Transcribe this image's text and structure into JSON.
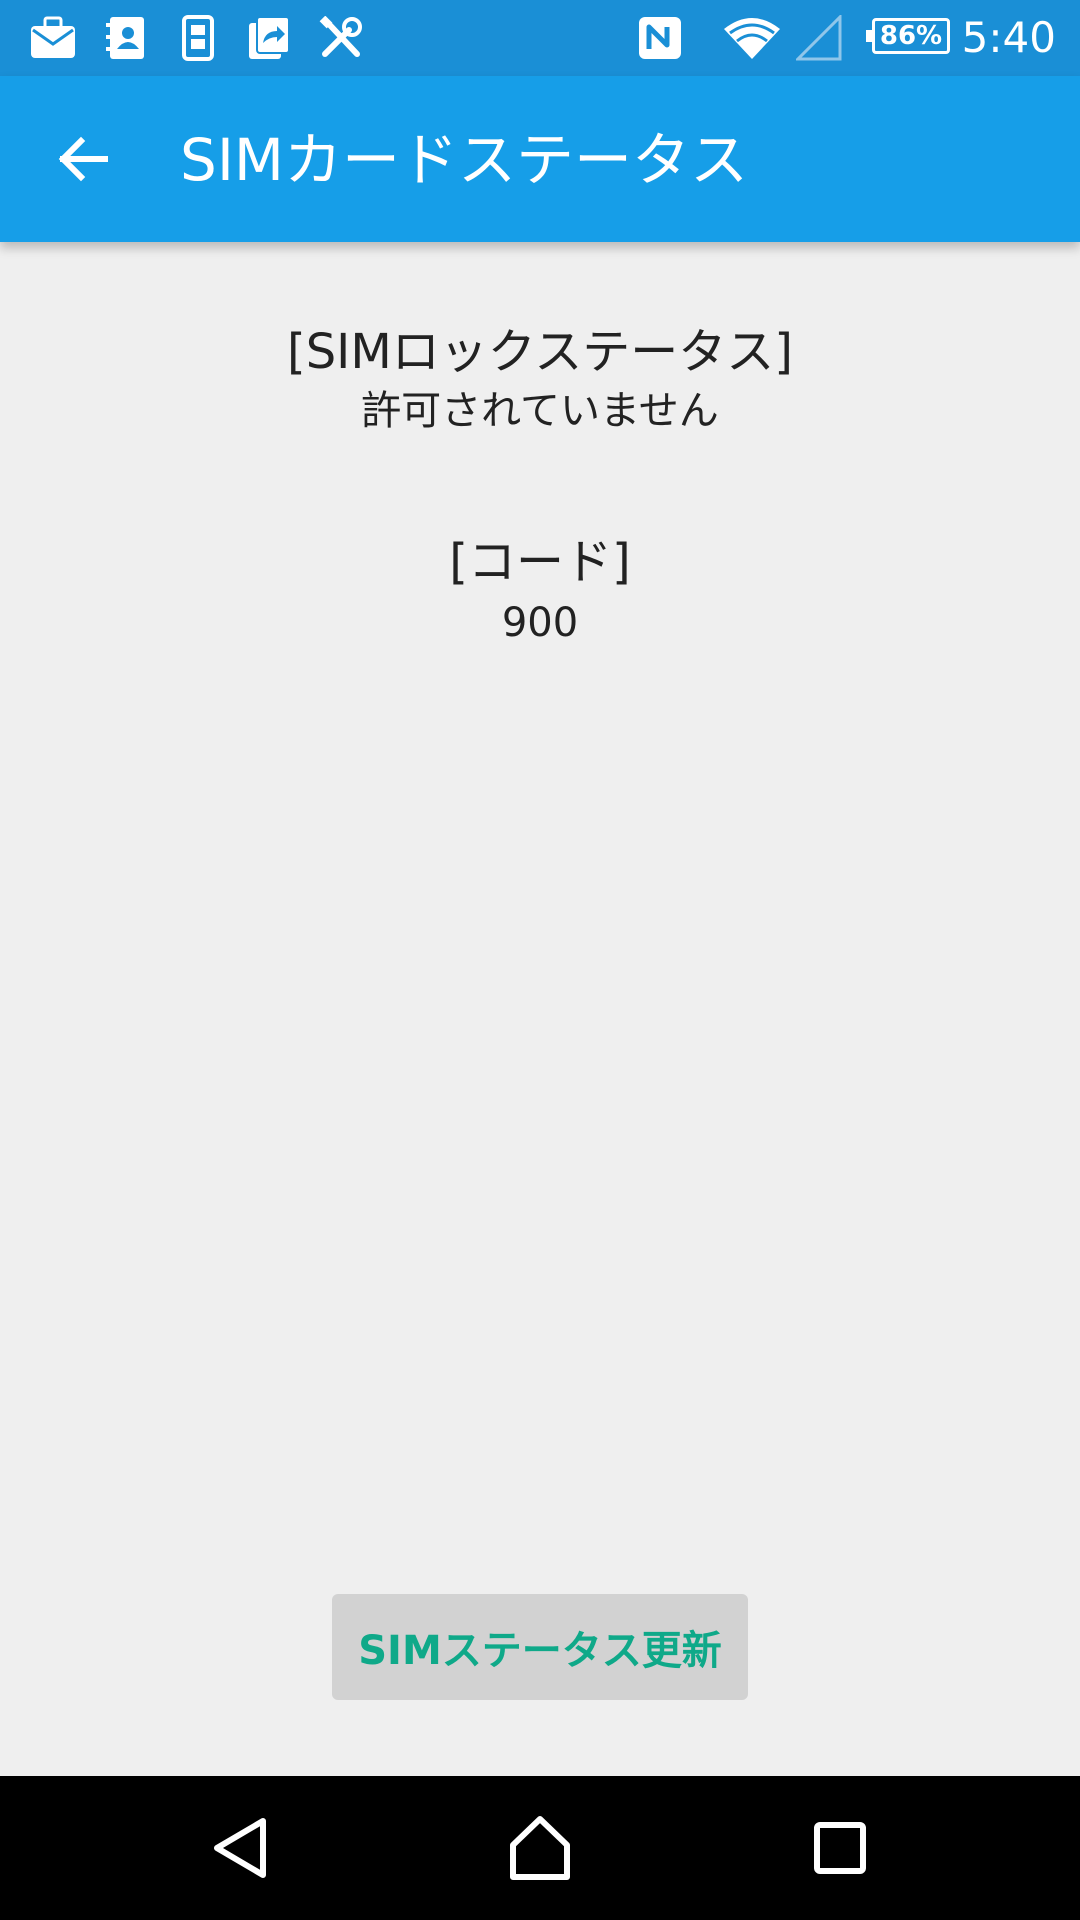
{
  "status_bar": {
    "time": "5:40",
    "battery_percent": "86%",
    "icons": [
      "au-mail-icon",
      "contacts-icon",
      "phone-app-icon",
      "share-icon",
      "tools-icon",
      "nfc-icon",
      "wifi-icon",
      "cell-signal-icon"
    ]
  },
  "app_bar": {
    "title": "SIMカードステータス"
  },
  "main": {
    "lock_status_label": "[SIMロックステータス]",
    "lock_status_value": "許可されていません",
    "code_label": "[コード]",
    "code_value": "900"
  },
  "actions": {
    "update_button": "SIMステータス更新"
  },
  "colors": {
    "status_bar": "#1a8fd6",
    "app_bar": "#169ee8",
    "background": "#efefef",
    "button_bg": "#d2d2d2",
    "button_text": "#0fa989"
  }
}
